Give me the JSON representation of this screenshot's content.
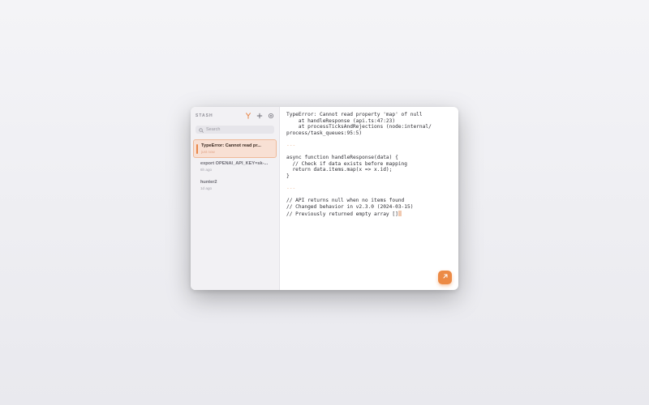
{
  "sidebar": {
    "app_name": "STASH",
    "search_placeholder": "Search",
    "items": [
      {
        "title": "TypeError: Cannot read pr...",
        "time": "just now"
      },
      {
        "title": "export OPENAI_API_KEY=sk-...",
        "time": "6h ago"
      },
      {
        "title": "hunter2",
        "time": "1d ago"
      }
    ]
  },
  "editor": {
    "lines": [
      "TypeError: Cannot read property 'map' of null",
      "    at handleResponse (api.ts:47:23)",
      "    at processTicksAndRejections (node:internal/",
      "process/task_queues:95:5)",
      "",
      "---",
      "",
      "async function handleResponse(data) {",
      "  // Check if data exists before mapping",
      "  return data.items.map(x => x.id);",
      "}",
      "",
      "---",
      "",
      "// API returns null when no items found",
      "// Changed behavior in v2.3.0 (2024-03-15)",
      "// Previously returned empty array []"
    ]
  },
  "colors": {
    "accent": "#ec8a45",
    "active_bg": "#f8e0d4"
  }
}
